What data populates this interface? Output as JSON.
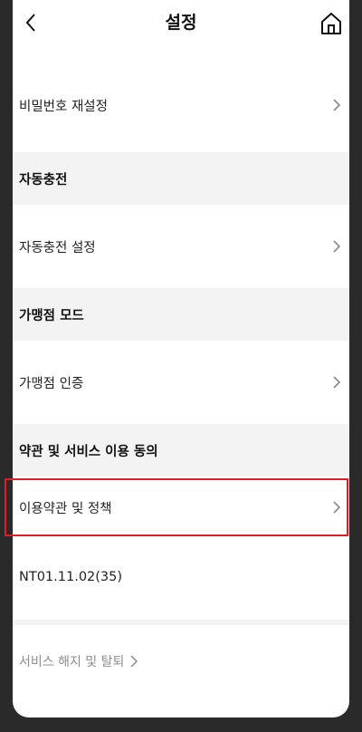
{
  "header": {
    "title": "설정",
    "back_icon": "chevron-left-icon",
    "home_icon": "home-icon"
  },
  "rows": {
    "password_reset": "비밀번호 재설정",
    "auto_charge_section": "자동충전",
    "auto_charge_settings": "자동충전 설정",
    "merchant_section": "가맹점 모드",
    "merchant_auth": "가맹점 인증",
    "terms_section": "약관 및 서비스 이용 동의",
    "terms_policy": "이용약관 및 정책"
  },
  "version": "NT01.11.02(35)",
  "withdraw": "서비스 해지 및 탈퇴",
  "colors": {
    "highlight": "#e01e2b",
    "section_bg": "#f3f3f3",
    "muted_text": "#8c8c8c"
  }
}
